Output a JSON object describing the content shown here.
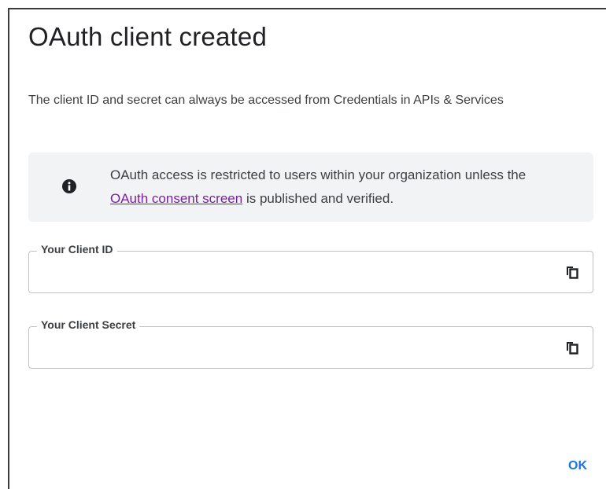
{
  "dialog": {
    "title": "OAuth client created",
    "description": "The client ID and secret can always be accessed from Credentials in APIs & Services",
    "info_banner": {
      "icon": "info-icon",
      "text_before": "OAuth access is restricted to users within your organization unless the ",
      "link_text": "OAuth consent screen",
      "text_after": " is published and verified."
    },
    "client_id": {
      "label": "Your Client ID",
      "value": "",
      "icon": "copy-icon"
    },
    "client_secret": {
      "label": "Your Client Secret",
      "value": "",
      "icon": "copy-icon"
    },
    "ok_label": "OK"
  },
  "colors": {
    "accent": "#1a73e8",
    "link": "#7b1fa2",
    "banner_bg": "#f1f3f4"
  }
}
